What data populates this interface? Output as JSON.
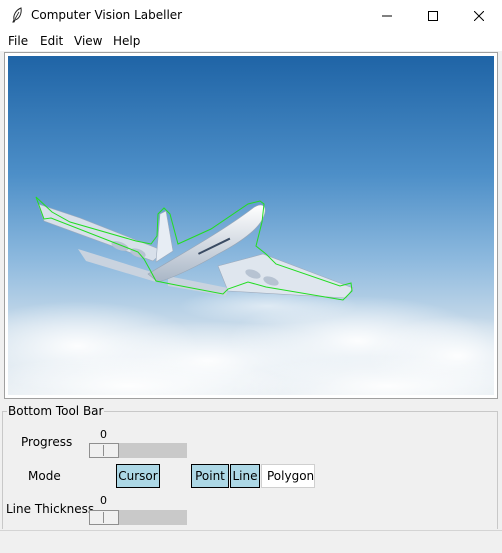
{
  "window": {
    "title": "Computer Vision Labeller",
    "controls": [
      "minimize-icon",
      "maximize-icon",
      "close-icon"
    ]
  },
  "menu": {
    "items": [
      {
        "label": "File"
      },
      {
        "label": "Edit"
      },
      {
        "label": "View"
      },
      {
        "label": "Help"
      }
    ]
  },
  "canvas": {
    "image_subject": "airplane-in-sky",
    "annotation_color": "#22dd22"
  },
  "toolbar": {
    "title": "Bottom Tool Bar",
    "progress": {
      "label": "Progress",
      "value": "0"
    },
    "mode": {
      "label": "Mode",
      "buttons": [
        {
          "label": "Cursor",
          "selected": false
        },
        {
          "label": "Point",
          "selected": false
        },
        {
          "label": "Line",
          "selected": false
        },
        {
          "label": "Polygon",
          "selected": true
        }
      ]
    },
    "line_thickness": {
      "label": "Line Thickness",
      "value": "0"
    }
  },
  "colors": {
    "button_bg": "#add8e6",
    "selected_bg": "#ffffff",
    "window_bg": "#f0f0f0"
  }
}
